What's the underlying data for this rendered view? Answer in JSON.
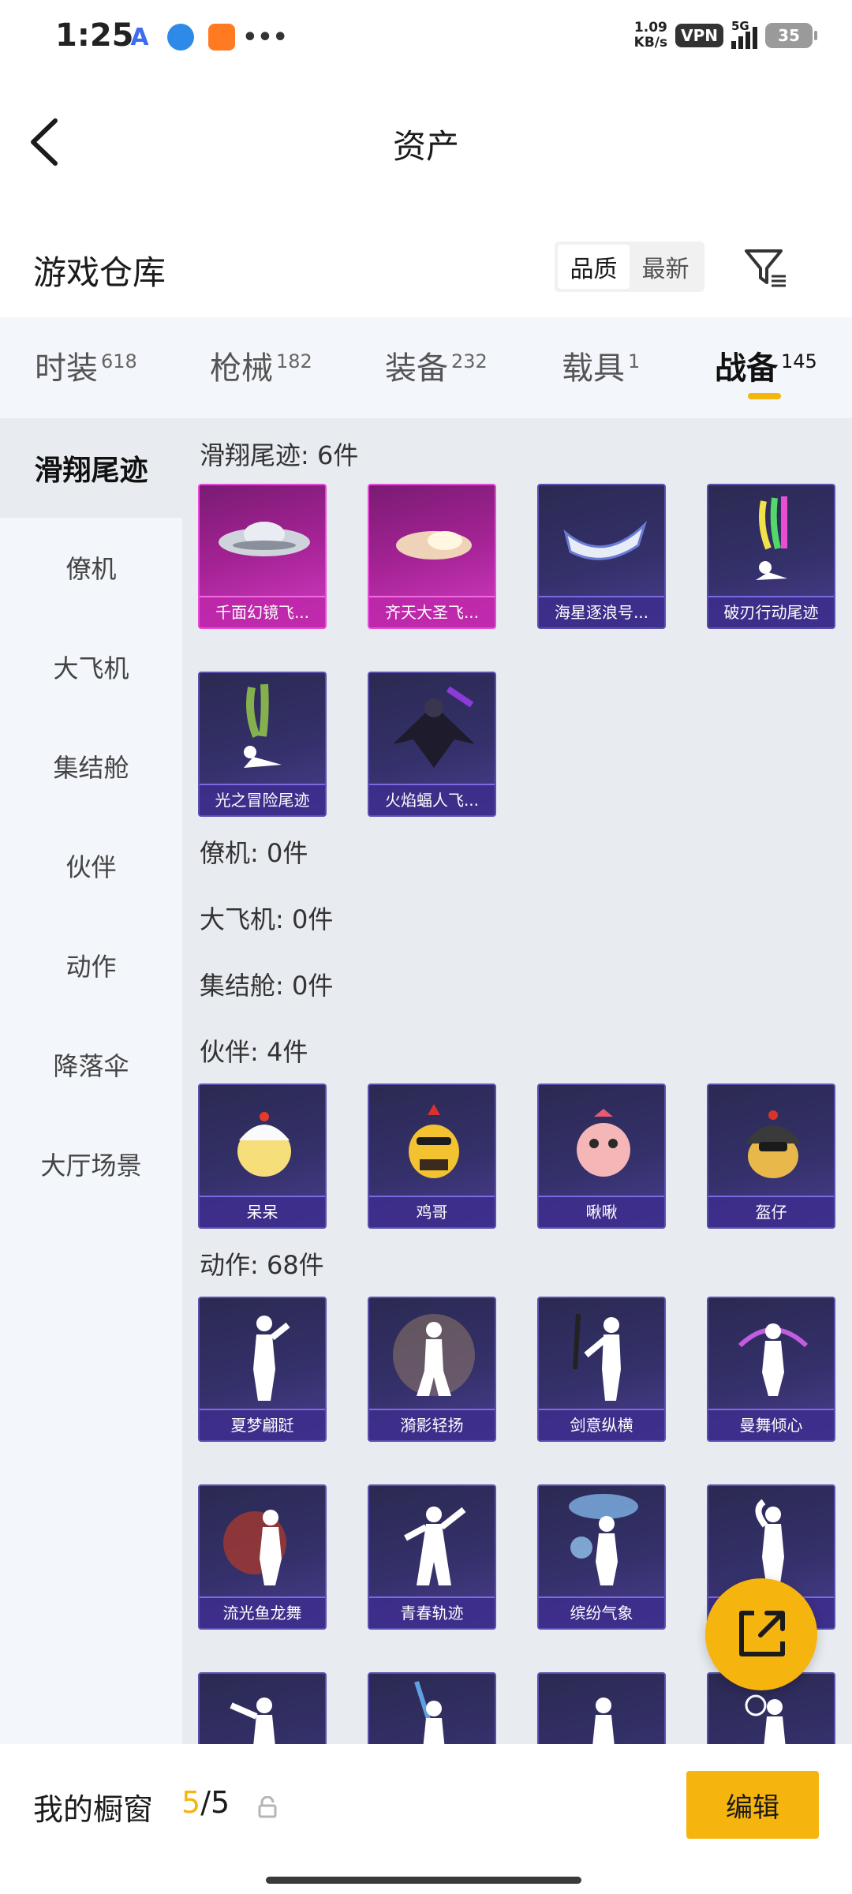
{
  "status_bar": {
    "time": "1:25",
    "app_icons": [
      "A",
      "",
      "",
      "•••"
    ],
    "net_speed_value": "1.09",
    "net_speed_unit": "KB/s",
    "vpn": "VPN",
    "network": "5G",
    "battery": "35"
  },
  "header": {
    "title": "资产"
  },
  "section": {
    "title": "游戏仓库",
    "sort_options": [
      "品质",
      "最新"
    ]
  },
  "tabs": [
    {
      "label": "时装",
      "count": "618"
    },
    {
      "label": "枪械",
      "count": "182"
    },
    {
      "label": "装备",
      "count": "232"
    },
    {
      "label": "载具",
      "count": "1"
    },
    {
      "label": "战备",
      "count": "145",
      "active": true
    }
  ],
  "sidebar": {
    "items": [
      "滑翔尾迹",
      "僚机",
      "大飞机",
      "集结舱",
      "伙伴",
      "动作",
      "降落伞",
      "大厅场景"
    ]
  },
  "groups": {
    "glide": {
      "title": "滑翔尾迹: 6件",
      "items": [
        "千面幻镜飞...",
        "齐天大圣飞...",
        "海星逐浪号...",
        "破刃行动尾迹",
        "光之冒险尾迹",
        "火焰蝠人飞..."
      ]
    },
    "wingman": {
      "title": "僚机: 0件"
    },
    "plane": {
      "title": "大飞机: 0件"
    },
    "pod": {
      "title": "集结舱: 0件"
    },
    "partner": {
      "title": "伙伴: 4件",
      "items": [
        "呆呆",
        "鸡哥",
        "啾啾",
        "盔仔"
      ]
    },
    "emote": {
      "title": "动作: 68件",
      "items": [
        "夏梦翩跹",
        "漪影轻扬",
        "剑意纵横",
        "曼舞倾心",
        "流光鱼龙舞",
        "青春轨迹",
        "缤纷气象",
        "",
        "",
        "",
        "",
        ""
      ]
    }
  },
  "bottom": {
    "label": "我的橱窗",
    "current": "5",
    "total": "/5",
    "edit": "编辑"
  }
}
